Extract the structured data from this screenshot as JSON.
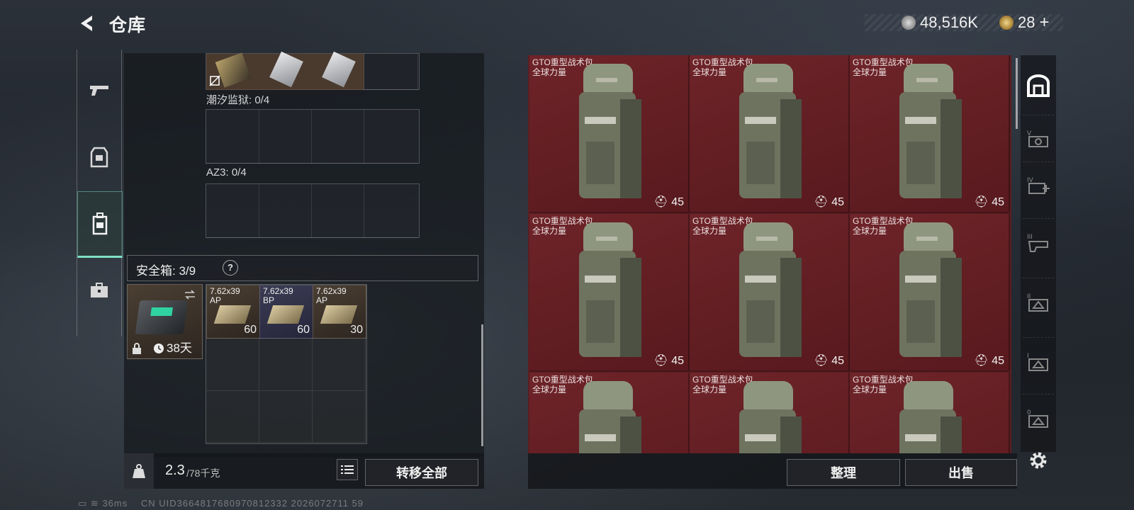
{
  "header": {
    "title": "仓库"
  },
  "currency": {
    "money": "48,516K",
    "tickets": "28",
    "plus": "+"
  },
  "left_rail": {
    "tabs": [
      "weapons",
      "armor",
      "backpack",
      "case"
    ],
    "active": 2
  },
  "containers": [
    {
      "label": "潮汐监狱: 0/4"
    },
    {
      "label": "AZ3: 0/4"
    }
  ],
  "safe_box": {
    "label": "安全箱: 3/9",
    "help": "?",
    "timer": "38天",
    "ammo": [
      {
        "caliber": "7.62x39",
        "type": "AP",
        "count": "60"
      },
      {
        "caliber": "7.62x39",
        "type": "BP",
        "count": "60"
      },
      {
        "caliber": "7.62x39",
        "type": "AP",
        "count": "30"
      }
    ]
  },
  "footer_left": {
    "weight": "2.3",
    "capacity": "/78千克",
    "transfer_all": "转移全部"
  },
  "stash": {
    "items": [
      {
        "name": "GTO重型战术包",
        "tag": "全球力量",
        "value": "45"
      },
      {
        "name": "GTO重型战术包",
        "tag": "全球力量",
        "value": "45"
      },
      {
        "name": "GTO重型战术包",
        "tag": "全球力量",
        "value": "45"
      },
      {
        "name": "GTO重型战术包",
        "tag": "全球力量",
        "value": "45"
      },
      {
        "name": "GTO重型战术包",
        "tag": "全球力量",
        "value": "45"
      },
      {
        "name": "GTO重型战术包",
        "tag": "全球力量",
        "value": "45"
      },
      {
        "name": "GTO重型战术包",
        "tag": "全球力量",
        "value": ""
      },
      {
        "name": "GTO重型战术包",
        "tag": "全球力量",
        "value": ""
      },
      {
        "name": "GTO重型战术包",
        "tag": "全球力量",
        "value": ""
      }
    ]
  },
  "footer_right": {
    "organize": "整理",
    "sell": "出售"
  },
  "right_rail": {
    "tabs": [
      "stash-icon",
      "V",
      "IV",
      "III",
      "II",
      "I",
      "0"
    ]
  },
  "status": {
    "ping": "36ms",
    "uid": "CN UID3664817680970812332 2026072711 59"
  },
  "colors": {
    "stash_item_bg": "#6e2429",
    "accent": "#7fe0c4"
  }
}
